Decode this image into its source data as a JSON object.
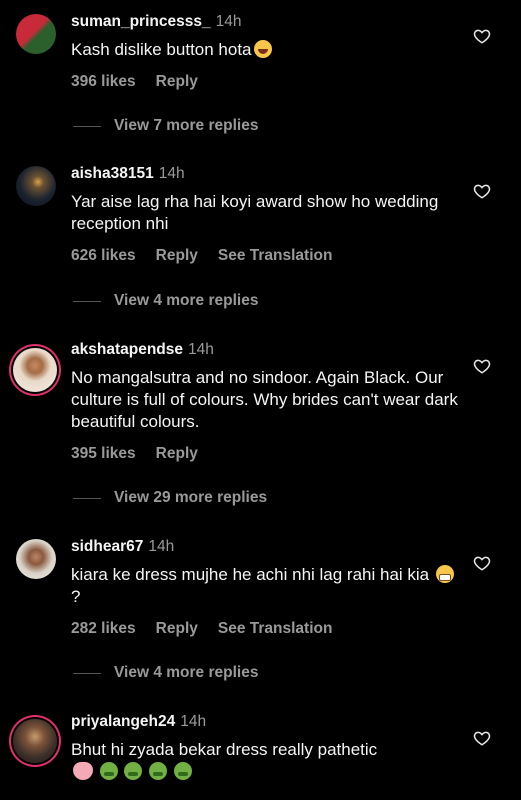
{
  "comments": [
    {
      "username": "suman_princesss_",
      "time": "14h",
      "text": "Kash dislike button hota",
      "likes": "396 likes",
      "reply": "Reply",
      "view_replies": "View 7 more replies",
      "avatar_colors": [
        "#c92a3a",
        "#2b5f2b"
      ],
      "emoji": [
        "laugh"
      ]
    },
    {
      "username": "aisha38151",
      "time": "14h",
      "text": "Yar aise lag rha hai koyi award show ho wedding reception nhi",
      "likes": "626 likes",
      "reply": "Reply",
      "translate": "See Translation",
      "view_replies": "View 4 more replies",
      "avatar_colors": [
        "#1a2330",
        "#b8843a"
      ]
    },
    {
      "username": "akshatapendse",
      "time": "14h",
      "text": "No mangalsutra and no sindoor. Again Black. Our culture is full of colours. Why brides can't wear dark beautiful colours.",
      "likes": "395 likes",
      "reply": "Reply",
      "view_replies": "View 29 more replies",
      "avatar_colors": [
        "#e9d9c8",
        "#7a5a3c"
      ]
    },
    {
      "username": "sidhear67",
      "time": "14h",
      "text": "kiara ke dress mujhe he achi nhi lag rahi hai kia",
      "text_suffix": "?",
      "likes": "282 likes",
      "reply": "Reply",
      "translate": "See Translation",
      "view_replies": "View 4 more replies",
      "avatar_colors": [
        "#d8d2c8",
        "#6b4a33"
      ],
      "emoji": [
        "grimace"
      ]
    },
    {
      "username": "priyalangeh24",
      "time": "14h",
      "text": "Bhut hi zyada bekar dress really pathetic",
      "avatar_colors": [
        "#3c2f2a",
        "#c99a6c"
      ],
      "emoji": [
        "pig",
        "sick",
        "sick",
        "sick",
        "sick"
      ]
    }
  ],
  "icons": {
    "like": "heart-outline-icon"
  },
  "colors": {
    "background": "#000000",
    "primary_text": "#f5f5f5",
    "secondary_text": "#9a9a9a",
    "story_ring": "#e1306c"
  }
}
